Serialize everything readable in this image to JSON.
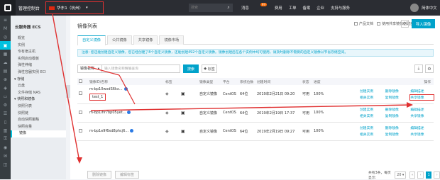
{
  "topbar": {
    "console_title": "管理控制台",
    "region": "华东1（杭州）",
    "search_placeholder": "搜索",
    "nav": [
      "消息",
      "费用",
      "工单",
      "备案",
      "企业",
      "支持与服务",
      "简体中文"
    ],
    "message_count": "99"
  },
  "sidebar": {
    "title": "云服务器 ECS",
    "items": [
      {
        "label": "概览",
        "group": false
      },
      {
        "label": "实例",
        "group": false
      },
      {
        "label": "专有宿主机",
        "group": false
      },
      {
        "label": "实例启动模板",
        "group": false
      },
      {
        "label": "弹性伸缩",
        "group": false
      },
      {
        "label": "弹性容器实例 ECI",
        "group": false
      },
      {
        "label": "▾ 存储",
        "group": true
      },
      {
        "label": "云盘",
        "group": false
      },
      {
        "label": "文件存储 NAS",
        "group": false
      },
      {
        "label": "▾ 快照和镜像",
        "group": true
      },
      {
        "label": "快照列表",
        "group": false
      },
      {
        "label": "快照链",
        "group": false
      },
      {
        "label": "自动快照策略",
        "group": false
      },
      {
        "label": "快照容量",
        "group": false
      },
      {
        "label": "镜像",
        "group": false,
        "active": true
      }
    ]
  },
  "main": {
    "title": "镜像列表",
    "product_doc": "产品文档",
    "use_shared": "使用共享镜像创建自定义镜像",
    "import_button": "导入镜像",
    "tabs": [
      "自定义镜像",
      "公共镜像",
      "共享镜像",
      "镜像市场"
    ],
    "notice": "注意: 您还能创建自定义镜像，您已经创建了8个自定义镜像，还能创建492个自定义镜像。镜像创建后在各个实例中均可使用，请及时删除不需要的自定义镜像以节省存储空间。",
    "filter": {
      "select_value": "镜像名称",
      "keyword_placeholder": "输入镜像名称精确查询",
      "search_button": "搜索",
      "tag_button": "标签"
    },
    "table": {
      "headers": [
        "",
        "镜像ID/名称",
        "标签",
        "",
        "镜像类型",
        "平台",
        "系统位数",
        "创建时间",
        "状态",
        "进度",
        "操作"
      ],
      "rows": [
        {
          "id": "m-bp10wxdS6kx...",
          "alias": "test_1",
          "type": "自定义镜像",
          "platform": "CentOS",
          "bits": "64位",
          "created": "2019年2月21日 09:20",
          "status": "可用",
          "progress": "100%",
          "ops": [
            "创建实例",
            "删除镜像",
            "编辑描述",
            "相关实例",
            "复制镜像",
            "共享镜像"
          ]
        },
        {
          "id": "m-bp1ihr7bp05yet...",
          "alias": "",
          "type": "自定义镜像",
          "platform": "CentOS",
          "bits": "64位",
          "created": "2019年2月19日 17:37",
          "status": "可用",
          "progress": "100%",
          "ops": [
            "创建实例",
            "删除镜像",
            "编辑描述",
            "相关实例",
            "复制镜像",
            "共享镜像"
          ]
        },
        {
          "id": "m-bp1e9f6xd8phcj6...",
          "alias": "",
          "type": "自定义镜像",
          "platform": "CentOS",
          "bits": "64位",
          "created": "2019年2月19日 09:27",
          "status": "可用",
          "progress": "100%",
          "ops": [
            "创建实例",
            "删除镜像",
            "编辑描述",
            "相关实例",
            "复制镜像",
            "共享镜像"
          ]
        }
      ]
    },
    "footer_buttons": [
      "删除镜像",
      "编辑标签"
    ],
    "pager": {
      "total": "共有3条，每页显示:",
      "page_size": "20",
      "current": "1"
    }
  },
  "colors": {
    "accent": "#00a2ca",
    "highlight": "#e03131",
    "topbar": "#2b2d33"
  }
}
